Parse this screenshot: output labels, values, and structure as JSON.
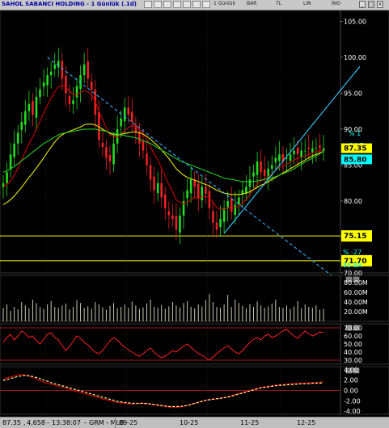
{
  "window": {
    "title": "SAHOL SABANCI HOLDING - 1 Günlük (.1d)",
    "toolbar": [
      "1 Günlük",
      "BAR",
      "TL",
      "LIN",
      "İNO"
    ],
    "colors": {
      "background": "#000000",
      "price_axis": "#ffffff",
      "highlight_label": "#ffff00",
      "current_label": "#00ffff"
    }
  },
  "status": {
    "price": "87.35",
    "volume": "4,658",
    "time": "13:38:07",
    "source": "GRM - MLB",
    "x_ticks": [
      "09-25",
      "10-25",
      "11-25",
      "12-25"
    ]
  },
  "chart_data": [
    {
      "type": "candlestick",
      "panel": "price",
      "title": "SAHOL SABANCI HOLDING - 1 Günlük (.1d)",
      "ylim": [
        70.0,
        106.5
      ],
      "yticks": [
        "105.00",
        "100.00",
        "95.00",
        "90.00",
        "85.00",
        "80.00",
        "75.00",
        "70.00"
      ],
      "x_ticks": [
        "09-25",
        "10-25",
        "11-25",
        "12-25"
      ],
      "x": [
        "08-14",
        "08-15",
        "08-18",
        "08-19",
        "08-20",
        "08-21",
        "08-22",
        "08-25",
        "08-26",
        "08-27",
        "08-28",
        "08-29",
        "09-01",
        "09-02",
        "09-03",
        "09-04",
        "09-05",
        "09-08",
        "09-09",
        "09-10",
        "09-11",
        "09-12",
        "09-15",
        "09-16",
        "09-17",
        "09-18",
        "09-19",
        "09-22",
        "09-23",
        "09-24",
        "09-25",
        "09-26",
        "09-29",
        "09-30",
        "10-01",
        "10-02",
        "10-03",
        "10-06",
        "10-07",
        "10-08",
        "10-09",
        "10-10",
        "10-13",
        "10-14",
        "10-15",
        "10-16",
        "10-17",
        "10-20",
        "10-21",
        "10-22",
        "10-23",
        "10-24",
        "10-27",
        "10-28",
        "10-30",
        "10-31",
        "11-03",
        "11-04",
        "11-05",
        "11-06",
        "11-07",
        "11-10",
        "11-11",
        "11-12",
        "11-13",
        "11-14",
        "11-17",
        "11-18",
        "11-19",
        "11-20",
        "11-21",
        "11-24",
        "11-25",
        "11-26",
        "11-27",
        "11-28",
        "12-01",
        "12-02",
        "12-03",
        "12-04",
        "12-05",
        "12-08",
        "12-09",
        "12-10",
        "12-11",
        "12-12",
        "12-15",
        "12-16"
      ],
      "close": [
        82.5,
        84.0,
        86.5,
        88.0,
        89.5,
        91.0,
        92.5,
        93.5,
        92.0,
        94.5,
        95.5,
        96.5,
        97.5,
        98.0,
        99.0,
        99.5,
        97.0,
        95.0,
        93.5,
        94.0,
        96.0,
        97.5,
        99.0,
        97.0,
        95.5,
        92.0,
        88.5,
        87.5,
        86.0,
        85.5,
        88.0,
        90.0,
        91.5,
        93.0,
        92.0,
        91.0,
        89.5,
        88.0,
        87.0,
        85.0,
        83.0,
        81.5,
        82.5,
        80.5,
        79.0,
        78.0,
        77.5,
        76.0,
        78.0,
        80.0,
        81.5,
        83.0,
        82.0,
        80.5,
        82.0,
        81.0,
        79.0,
        77.0,
        76.0,
        77.5,
        79.0,
        80.0,
        78.5,
        79.5,
        80.5,
        81.5,
        82.0,
        83.0,
        84.0,
        85.5,
        84.0,
        83.5,
        84.5,
        85.0,
        86.0,
        86.5,
        85.5,
        86.0,
        86.5,
        87.0,
        86.5,
        87.0,
        87.0,
        87.2,
        87.35,
        87.35,
        87.35,
        87.35
      ],
      "series": [
        {
          "name": "MA1",
          "color": "#cc0000",
          "values": [
            82.0,
            82.3,
            82.8,
            83.6,
            84.6,
            85.7,
            86.9,
            88.0,
            88.9,
            90.0,
            91.1,
            92.2,
            93.3,
            94.3,
            95.2,
            95.9,
            96.1,
            95.8,
            95.3,
            94.8,
            94.8,
            95.1,
            95.4,
            95.2,
            94.8,
            93.8,
            92.5,
            91.3,
            90.2,
            89.2,
            88.9,
            88.9,
            89.2,
            89.8,
            90.2,
            90.5,
            90.3,
            89.9,
            89.4,
            88.6,
            87.6,
            86.5,
            85.7,
            84.6,
            83.4,
            82.3,
            81.3,
            80.2,
            79.8,
            79.6,
            79.8,
            80.2,
            80.5,
            80.4,
            80.6,
            80.7,
            80.4,
            79.8,
            79.1,
            78.9,
            78.8,
            79.1,
            79.0,
            79.1,
            79.3,
            79.8,
            80.2,
            80.9,
            81.6,
            82.4,
            82.8,
            83.0,
            83.4,
            83.8,
            84.3,
            84.7,
            84.9,
            85.1,
            85.4,
            85.7,
            85.9,
            86.1,
            86.3,
            86.5,
            86.7,
            86.9,
            87.0,
            87.1
          ]
        },
        {
          "name": "MA2",
          "color": "#e8e800",
          "values": [
            79.5,
            79.8,
            80.2,
            80.7,
            81.3,
            81.9,
            82.6,
            83.3,
            83.9,
            84.6,
            85.3,
            86.0,
            86.8,
            87.5,
            88.2,
            88.8,
            89.2,
            89.5,
            89.7,
            89.9,
            90.1,
            90.3,
            90.6,
            90.7,
            90.7,
            90.6,
            90.3,
            90.0,
            89.7,
            89.4,
            89.2,
            89.2,
            89.3,
            89.4,
            89.5,
            89.6,
            89.6,
            89.5,
            89.3,
            89.0,
            88.6,
            88.1,
            87.7,
            87.1,
            86.5,
            85.9,
            85.2,
            84.5,
            84.0,
            83.6,
            83.3,
            83.1,
            82.9,
            82.7,
            82.5,
            82.3,
            82.1,
            81.8,
            81.5,
            81.3,
            81.1,
            81.0,
            80.9,
            80.9,
            80.9,
            81.0,
            81.1,
            81.3,
            81.6,
            81.9,
            82.2,
            82.4,
            82.7,
            83.0,
            83.3,
            83.6,
            83.9,
            84.2,
            84.5,
            84.8,
            85.1,
            85.4,
            85.7,
            86.0,
            86.3,
            86.5,
            86.7,
            86.9
          ]
        },
        {
          "name": "MA3",
          "color": "#22cc22",
          "values": [
            84.0,
            84.2,
            84.5,
            84.8,
            85.2,
            85.6,
            86.0,
            86.4,
            86.8,
            87.2,
            87.6,
            88.0,
            88.3,
            88.6,
            88.9,
            89.2,
            89.4,
            89.5,
            89.6,
            89.7,
            89.8,
            89.9,
            90.0,
            90.0,
            90.0,
            90.0,
            89.9,
            89.8,
            89.7,
            89.5,
            89.4,
            89.3,
            89.2,
            89.1,
            89.0,
            88.9,
            88.8,
            88.6,
            88.4,
            88.2,
            88.0,
            87.7,
            87.4,
            87.1,
            86.8,
            86.5,
            86.2,
            85.9,
            85.6,
            85.4,
            85.2,
            85.0,
            84.8,
            84.6,
            84.4,
            84.2,
            84.0,
            83.8,
            83.6,
            83.4,
            83.2,
            83.1,
            83.0,
            82.9,
            82.8,
            82.7,
            82.7,
            82.7,
            82.7,
            82.8,
            82.9,
            83.0,
            83.1,
            83.2,
            83.4,
            83.6,
            83.8,
            84.0,
            84.2,
            84.5,
            84.8,
            85.1,
            85.4,
            85.7,
            86.0,
            86.3,
            86.6,
            86.9
          ]
        }
      ],
      "levels": [
        {
          "label": "75.15",
          "value": 75.15,
          "color": "#ffff00"
        },
        {
          "label": "71.70",
          "value": 71.7,
          "color": "#ffff00"
        }
      ],
      "price_labels": [
        {
          "label": "87.35",
          "value": 87.35,
          "color": "#ffff00"
        },
        {
          "label": "85.80",
          "value": 85.8,
          "color": "#00ffff"
        }
      ],
      "trendlines": [
        {
          "label": "% -27",
          "style": "dashed",
          "color": "#33aaff",
          "from": [
            "09-01",
            100.0
          ],
          "to": [
            "12-16",
            70.5
          ]
        },
        {
          "label": "% 1",
          "style": "solid",
          "color": "#33ccff",
          "from": [
            "11-07",
            75.5
          ],
          "to": [
            "12-16",
            92.5
          ]
        }
      ],
      "annotations": [
        "% 1",
        "30 E",
        "% -27",
        "85 BA"
      ]
    },
    {
      "type": "bar",
      "panel": "volume",
      "ylabel": "",
      "yticks": [
        "80.00M",
        "60.00M",
        "40.00M",
        "20.00M"
      ],
      "ylim": [
        0,
        95
      ],
      "values": [
        28,
        35,
        22,
        30,
        25,
        40,
        33,
        27,
        45,
        38,
        30,
        26,
        35,
        42,
        30,
        28,
        33,
        37,
        25,
        30,
        44,
        38,
        28,
        31,
        26,
        40,
        35,
        29,
        24,
        32,
        38,
        27,
        30,
        35,
        28,
        41,
        33,
        26,
        29,
        37,
        45,
        30,
        28,
        34,
        26,
        31,
        40,
        33,
        29,
        38,
        42,
        30,
        27,
        35,
        31,
        44,
        57,
        40,
        30,
        28,
        35,
        55,
        30,
        45,
        38,
        32,
        27,
        36,
        30,
        41,
        33,
        28,
        31,
        37,
        45,
        30,
        28,
        33,
        26,
        31,
        42,
        27,
        35,
        30,
        28,
        33,
        24,
        26
      ]
    },
    {
      "type": "line",
      "panel": "oscillator",
      "yticks": [
        "70.00",
        "60.00",
        "50.00",
        "40.00",
        "30.00"
      ],
      "ylim": [
        25,
        75
      ],
      "levels": [
        70,
        30
      ],
      "series": [
        {
          "name": "OSC",
          "color": "#ff2222",
          "values": [
            52,
            58,
            62,
            55,
            60,
            66,
            63,
            58,
            60,
            54,
            50,
            56,
            62,
            64,
            58,
            55,
            48,
            42,
            47,
            53,
            60,
            57,
            52,
            49,
            44,
            40,
            38,
            42,
            48,
            54,
            58,
            55,
            50,
            46,
            43,
            40,
            37,
            35,
            38,
            42,
            45,
            40,
            36,
            33,
            35,
            38,
            42,
            40,
            44,
            47,
            50,
            46,
            42,
            38,
            36,
            33,
            30,
            34,
            38,
            42,
            45,
            48,
            44,
            40,
            38,
            42,
            47,
            52,
            56,
            58,
            55,
            60,
            62,
            58,
            60,
            63,
            66,
            68,
            64,
            60,
            57,
            62,
            66,
            63,
            60,
            62,
            65,
            64
          ]
        }
      ]
    },
    {
      "type": "line",
      "panel": "macd",
      "yticks": [
        "4.00",
        "2.00",
        "0.00",
        "-2.00",
        "-4.00"
      ],
      "ylim": [
        -4.6,
        4.6
      ],
      "series": [
        {
          "name": "MACD",
          "color": "#cc0000",
          "values": [
            2.2,
            2.4,
            2.6,
            2.8,
            3.0,
            3.1,
            3.0,
            2.8,
            2.5,
            2.2,
            1.9,
            1.6,
            1.4,
            1.2,
            1.0,
            0.8,
            0.6,
            0.4,
            0.2,
            0.0,
            -0.2,
            -0.4,
            -0.6,
            -0.8,
            -1.0,
            -1.2,
            -1.4,
            -1.6,
            -1.8,
            -2.0,
            -2.2,
            -2.3,
            -2.4,
            -2.5,
            -2.6,
            -2.6,
            -2.6,
            -2.5,
            -2.5,
            -2.6,
            -2.7,
            -2.8,
            -2.9,
            -3.0,
            -3.1,
            -3.2,
            -3.3,
            -3.3,
            -3.2,
            -3.1,
            -2.9,
            -2.7,
            -2.5,
            -2.3,
            -2.1,
            -1.9,
            -1.8,
            -1.7,
            -1.6,
            -1.5,
            -1.4,
            -1.2,
            -1.0,
            -0.8,
            -0.6,
            -0.4,
            -0.2,
            0.0,
            0.2,
            0.4,
            0.6,
            0.7,
            0.8,
            0.9,
            1.0,
            1.1,
            1.2,
            1.2,
            1.3,
            1.3,
            1.4,
            1.4,
            1.4,
            1.5,
            1.5,
            1.5,
            1.6,
            1.6
          ]
        },
        {
          "name": "Signal",
          "color": "#ffff99",
          "values": [
            1.9,
            2.1,
            2.3,
            2.5,
            2.7,
            2.8,
            2.9,
            2.8,
            2.7,
            2.5,
            2.3,
            2.0,
            1.8,
            1.5,
            1.3,
            1.1,
            0.9,
            0.7,
            0.5,
            0.3,
            0.1,
            -0.1,
            -0.3,
            -0.5,
            -0.7,
            -0.9,
            -1.1,
            -1.3,
            -1.5,
            -1.7,
            -1.9,
            -2.1,
            -2.2,
            -2.3,
            -2.4,
            -2.5,
            -2.5,
            -2.5,
            -2.5,
            -2.5,
            -2.6,
            -2.7,
            -2.8,
            -2.9,
            -3.0,
            -3.1,
            -3.1,
            -3.1,
            -3.1,
            -3.0,
            -2.9,
            -2.7,
            -2.5,
            -2.3,
            -2.1,
            -1.9,
            -1.8,
            -1.7,
            -1.6,
            -1.5,
            -1.4,
            -1.3,
            -1.1,
            -0.9,
            -0.7,
            -0.5,
            -0.3,
            -0.1,
            0.1,
            0.3,
            0.5,
            0.6,
            0.7,
            0.8,
            0.9,
            1.0,
            1.0,
            1.1,
            1.1,
            1.2,
            1.2,
            1.3,
            1.3,
            1.3,
            1.4,
            1.4,
            1.4,
            1.5
          ]
        }
      ]
    }
  ]
}
